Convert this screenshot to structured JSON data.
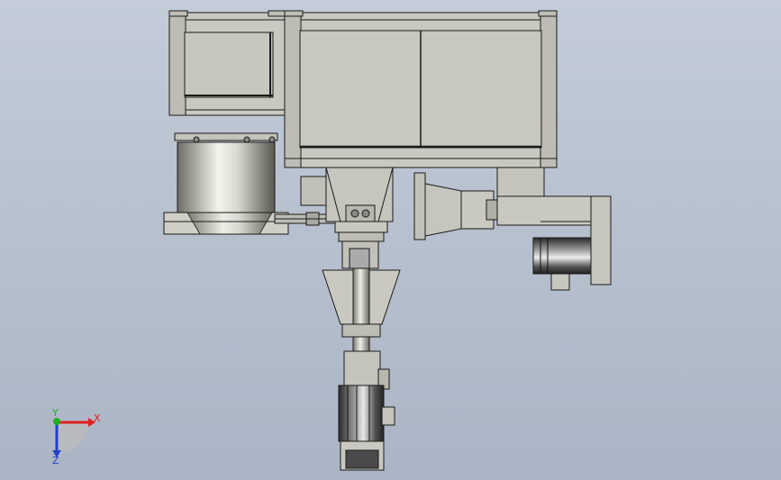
{
  "viewport": {
    "background_top": "#c3ccd8",
    "background_bottom": "#aab4c4"
  },
  "model": {
    "part_fill": "#c9c9c1",
    "part_stroke": "#1a1a1a",
    "cylinder_dark": "#5a5a52",
    "cylinder_light": "#f4f4ee",
    "motor_dark": "#2e2e2e"
  },
  "triad": {
    "x_label": "X",
    "y_label": "Y",
    "z_label": "Z",
    "x_color": "#e02020",
    "y_color": "#20b020",
    "z_color": "#2040d0"
  }
}
